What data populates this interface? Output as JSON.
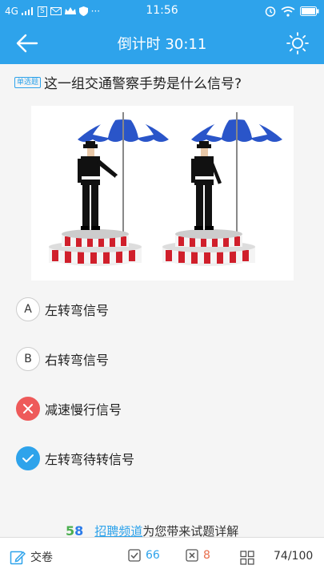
{
  "statusbar": {
    "network": "4G",
    "time": "11:56",
    "more": "···"
  },
  "header": {
    "title": "倒计时 30:11"
  },
  "question": {
    "tag": "单选题",
    "text": "这一组交通警察手势是什么信号?"
  },
  "options": [
    {
      "marker": "A",
      "label": "左转弯信号",
      "state": "normal"
    },
    {
      "marker": "B",
      "label": "右转弯信号",
      "state": "normal"
    },
    {
      "marker": "",
      "label": "减速慢行信号",
      "state": "wrong"
    },
    {
      "marker": "",
      "label": "左转弯待转信号",
      "state": "correct"
    }
  ],
  "promo": {
    "logo_green": "5",
    "logo_blue": "8",
    "link_text": "招聘频道",
    "text": "为您带来试题详解"
  },
  "bottombar": {
    "submit_label": "交卷",
    "correct_count": "66",
    "wrong_count": "8",
    "progress": "74/100"
  },
  "colors": {
    "accent": "#2ea3eb",
    "wrong": "#ee5a5a",
    "correct_count": "#2ea3eb",
    "wrong_count": "#e86c4a"
  }
}
